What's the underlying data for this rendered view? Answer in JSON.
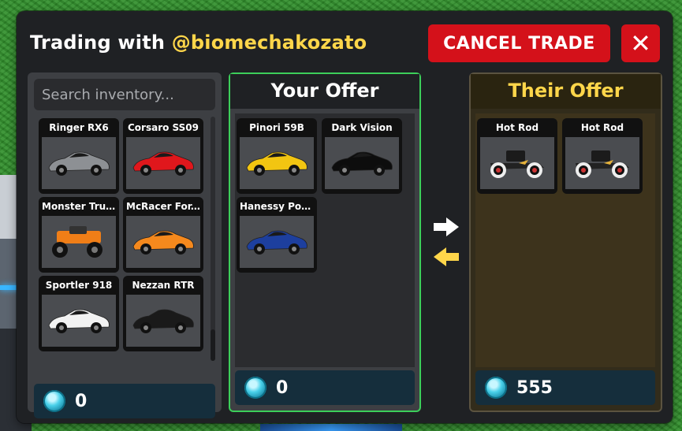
{
  "header": {
    "title_prefix": "Trading with ",
    "username": "@biomechakozato",
    "cancel_label": "CANCEL TRADE",
    "close_label": "✕"
  },
  "inventory": {
    "search_placeholder": "Search inventory...",
    "balance": "0",
    "items": [
      {
        "name": "Ringer RX6",
        "color": "#8d9094"
      },
      {
        "name": "Corsaro SS09",
        "color": "#e0171c"
      },
      {
        "name": "Monster Truck",
        "color": "#f07e17"
      },
      {
        "name": "McRacer For...",
        "color": "#f5891d"
      },
      {
        "name": "Sportler 918",
        "color": "#f2f2f2"
      },
      {
        "name": "Nezzan RTR",
        "color": "#1a1a1a"
      }
    ]
  },
  "your_offer": {
    "title": "Your Offer",
    "balance": "0",
    "items": [
      {
        "name": "Pinori 59B",
        "color": "#f2c511"
      },
      {
        "name": "Dark Vision",
        "color": "#0d0d0d"
      },
      {
        "name": "Hanessy Pois...",
        "color": "#1d3f9e"
      }
    ]
  },
  "their_offer": {
    "title": "Their Offer",
    "balance": "555",
    "items": [
      {
        "name": "Hot Rod",
        "color": "#222222"
      },
      {
        "name": "Hot Rod",
        "color": "#222222"
      }
    ]
  },
  "icons": {
    "send_arrow": "arrow-right-icon",
    "receive_arrow": "arrow-left-icon",
    "currency": "coin-icon"
  },
  "colors": {
    "accent_green": "#3ccf5a",
    "accent_yellow": "#ffd64a",
    "cancel_red": "#d4111a"
  }
}
